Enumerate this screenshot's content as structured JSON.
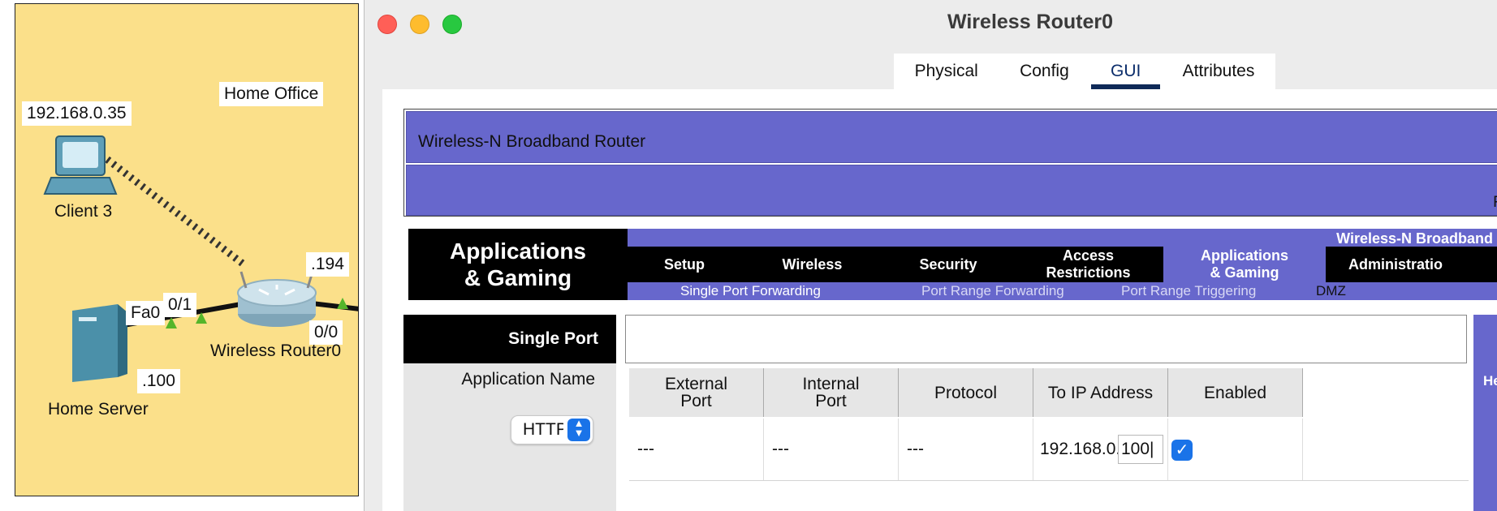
{
  "topology": {
    "area_label": "Home Office",
    "client_ip": "192.168.0.35",
    "client_name": "Client 3",
    "server_name": "Home Server",
    "server_ip_suffix": ".100",
    "router_name": "Wireless Router0",
    "router_ip_suffix": ".194",
    "port_fa0": "Fa0",
    "port_0_1": "0/1",
    "port_0_0": "0/0"
  },
  "window": {
    "title": "Wireless Router0",
    "tabs": [
      "Physical",
      "Config",
      "GUI",
      "Attributes"
    ],
    "active_tab": "GUI"
  },
  "router": {
    "product_name": "Wireless-N Broadband Router",
    "firmware_text": "Fi",
    "section_title_line1": "Applications",
    "section_title_line2": "& Gaming",
    "nav_product": "Wireless-N Broadband R",
    "nav": [
      {
        "label1": "Setup",
        "label2": ""
      },
      {
        "label1": "Wireless",
        "label2": ""
      },
      {
        "label1": "Security",
        "label2": ""
      },
      {
        "label1": "Access",
        "label2": "Restrictions"
      },
      {
        "label1": "Applications",
        "label2": "& Gaming"
      },
      {
        "label1": "Administratio",
        "label2": ""
      }
    ],
    "subnav": [
      "Single Port Forwarding",
      "Port Range Forwarding",
      "Port Range Triggering",
      "DMZ"
    ],
    "sidebar_label": "Single Port",
    "app_name_label": "Application Name",
    "app_select_value": "HTTP",
    "help_label": "Help...",
    "table_headers": [
      {
        "line1": "External",
        "line2": "Port"
      },
      {
        "line1": "Internal",
        "line2": "Port"
      },
      {
        "line1": "Protocol",
        "line2": ""
      },
      {
        "line1": "To IP Address",
        "line2": ""
      },
      {
        "line1": "Enabled",
        "line2": ""
      }
    ],
    "row": {
      "external_port": "---",
      "internal_port": "---",
      "protocol": "---",
      "ip_prefix": "192.168.0.",
      "ip_last": "100|",
      "enabled": true
    }
  },
  "colors": {
    "router_blue": "#6767cc",
    "topology_bg": "#fbe08a",
    "close": "#ff5f57",
    "minimize": "#febc2e",
    "zoom": "#28c840"
  }
}
